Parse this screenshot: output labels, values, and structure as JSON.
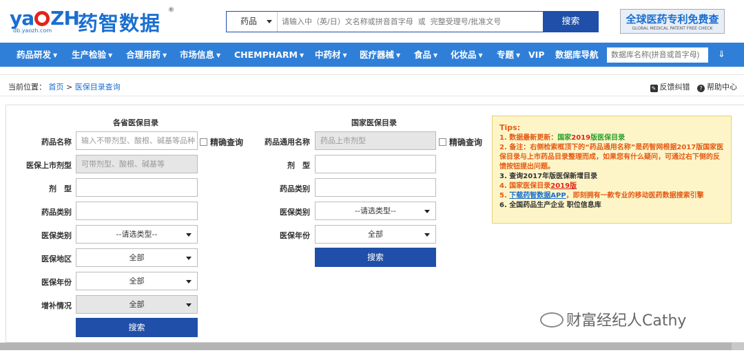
{
  "brand": {
    "logo_en_left": "ya",
    "logo_en_right": "ZH",
    "logo_sub": "db.yaozh.com",
    "logo_cn": "药智数据",
    "reg": "®"
  },
  "search": {
    "category": "药品",
    "placeholder": "请输入中（英/日）文名称或拼音首字母  或  完整受理号/批准文号",
    "button": "搜索"
  },
  "patent_banner": {
    "line1": "全球医药专利免费查",
    "line2": "GLOBAL MEDICAL PATENT FREE CHECK"
  },
  "nav": {
    "items": [
      "药品研发",
      "生产检验",
      "合理用药",
      "市场信息",
      "CHEMPHARM",
      "中药材",
      "医疗器械",
      "食品",
      "化妆品",
      "专题",
      "VIP",
      "数据库导航"
    ],
    "search_placeholder": "数据库名称(拼音或首字母)",
    "expand_icon": "double-chevron-down"
  },
  "breadcrumb": {
    "prefix": "当前位置：",
    "home": "首页",
    "sep": ">",
    "current": "医保目录查询",
    "feedback": "反馈纠错",
    "help": "帮助中心"
  },
  "provincial": {
    "title": "各省医保目录",
    "drug_name_label": "药品名称",
    "drug_name_placeholder": "输入不带剂型、酸根、碱基等品种",
    "exact_label": "精确查询",
    "form_label": "医保上市剂型",
    "form_placeholder": "可带剂型、酸根、碱基等",
    "dosage_label": "剂　型",
    "category_label": "药品类别",
    "ins_type_label": "医保类别",
    "ins_type_value": "--请选类型--",
    "region_label": "医保地区",
    "region_value": "全部",
    "year_label": "医保年份",
    "year_value": "全部",
    "supp_label": "增补情况",
    "supp_value": "全部",
    "search_button": "搜索"
  },
  "national": {
    "title": "国家医保目录",
    "generic_label": "药品通用名称",
    "generic_placeholder": "药品上市剂型",
    "exact_label": "精确查询",
    "dosage_label": "剂　型",
    "category_label": "药品类别",
    "ins_type_label": "医保类别",
    "ins_type_value": "--请选类型--",
    "year_label": "医保年份",
    "year_value": "全部",
    "search_button": "搜索"
  },
  "tips": {
    "title": "Tips:",
    "l1_a": "1. 数据最新更新：",
    "l1_b": "国家",
    "l1_c": "2019",
    "l1_d": "版医保目录",
    "l2": "2. 备注：右侧检索框顶下的“药品通用名称”是药智网根据2017版国家医保目录与上市药品目录整理而成，如果您有什么疑问，可通过右下侧的反馈按钮提出问题。",
    "l3": "3. 查询2017年版医保新增目录",
    "l4_a": "4. 国家医保目录",
    "l4_b": "2019版",
    "l5_a": "5. ",
    "l5_b": "下载药智数据APP",
    "l5_c": "，即刻拥有一款专业的移动医药数据搜索引擎",
    "l6": "6. 全国药品生产企业 职位信息库"
  },
  "watermark": "财富经纪人Cathy"
}
